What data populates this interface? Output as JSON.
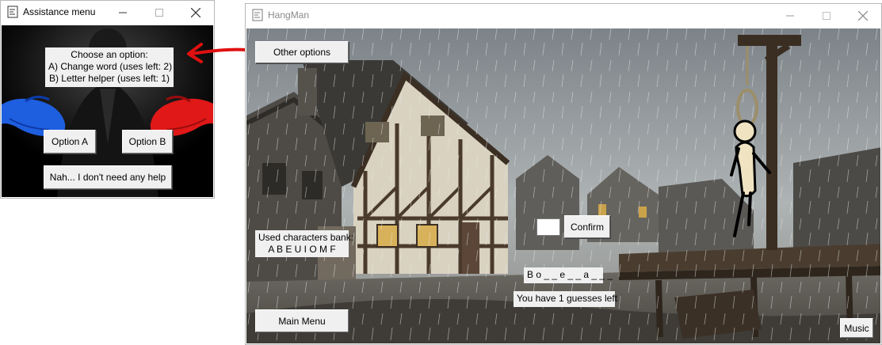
{
  "assist_window": {
    "title": "Assistance menu",
    "prompt": {
      "line1": "Choose an option:",
      "line2": "A) Change word (uses left: 2)",
      "line3": "B) Letter helper (uses left: 1)"
    },
    "option_a_label": "Option A",
    "option_b_label": "Option B",
    "no_help_label": "Nah... I don't need any help"
  },
  "game_window": {
    "title": "HangMan",
    "other_options_label": "Other options",
    "used_bank_title": "Used characters bank:",
    "used_bank_value": "A B E U I O M F",
    "letter_input_value": "",
    "confirm_label": "Confirm",
    "word_display": "B o _ _ e _ _ a _ _ _",
    "guesses_left": "You have 1 guesses left",
    "main_menu_label": "Main Menu",
    "music_label": "Music"
  },
  "colors": {
    "annotation_arrow": "#e01010",
    "left_hand": "#1e5fe0",
    "right_hand": "#e01818"
  },
  "icons": {
    "app": "app-icon",
    "minimize": "minimize-icon",
    "maximize": "maximize-icon",
    "close": "close-icon"
  }
}
